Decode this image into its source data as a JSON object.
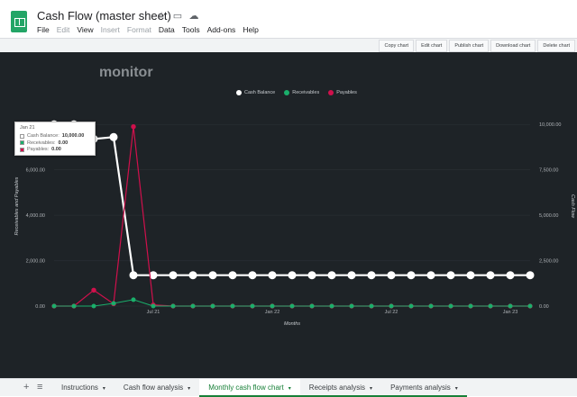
{
  "doc": {
    "title": "Cash Flow (master sheet)"
  },
  "icons": [
    "star-icon",
    "folder-move-icon",
    "cloud-status-icon"
  ],
  "menu": [
    {
      "label": "File",
      "disabled": false
    },
    {
      "label": "Edit",
      "disabled": true
    },
    {
      "label": "View",
      "disabled": false
    },
    {
      "label": "Insert",
      "disabled": true
    },
    {
      "label": "Format",
      "disabled": true
    },
    {
      "label": "Data",
      "disabled": false
    },
    {
      "label": "Tools",
      "disabled": false
    },
    {
      "label": "Add-ons",
      "disabled": false
    },
    {
      "label": "Help",
      "disabled": false
    }
  ],
  "chart_buttons": [
    "Copy chart",
    "Edit chart",
    "Publish chart",
    "Download chart",
    "Delete chart"
  ],
  "chart_title_visible": "monitor",
  "tooltip": {
    "date": "Jan 21",
    "rows": [
      {
        "label": "Cash Balance:",
        "value": "10,000.00",
        "color": "#ffffff"
      },
      {
        "label": "Receivables:",
        "value": "0.00",
        "color": "#1aaf6b"
      },
      {
        "label": "Payables:",
        "value": "0.00",
        "color": "#d0104c"
      }
    ]
  },
  "chart_data": {
    "type": "line",
    "xlabel": "Months",
    "ylabel_left": "Receivables and Payables",
    "ylabel_right": "Cash Flow",
    "x_ticks": [
      "Jul 21",
      "Jan 22",
      "Jul 22",
      "Jan 23"
    ],
    "y_left_ticks": [
      "0.00",
      "2,000.00",
      "4,000.00",
      "6,000.00",
      "8,000.00"
    ],
    "y_right_ticks": [
      "0.00",
      "2,500.00",
      "5,000.00",
      "7,500.00",
      "10,000.00"
    ],
    "ylim_left": [
      0,
      8800
    ],
    "ylim_right": [
      0,
      11000
    ],
    "legend_position": "top",
    "colors": {
      "cash": "#ffffff",
      "receivables": "#1aaf6b",
      "payables": "#d0104c"
    },
    "series": [
      {
        "name": "Cash Balance",
        "axis": "right",
        "values": [
          10000,
          10000,
          9200,
          9300,
          1700,
          1700,
          1700,
          1700,
          1700,
          1700,
          1700,
          1700,
          1700,
          1700,
          1700,
          1700,
          1700,
          1700,
          1700,
          1700,
          1700,
          1700,
          1700,
          1700,
          1700
        ]
      },
      {
        "name": "Receivables",
        "axis": "left",
        "values": [
          0,
          0,
          0,
          120,
          280,
          0,
          0,
          0,
          0,
          0,
          0,
          0,
          0,
          0,
          0,
          0,
          0,
          0,
          0,
          0,
          0,
          0,
          0,
          0,
          0
        ]
      },
      {
        "name": "Payables",
        "axis": "left",
        "values": [
          0,
          0,
          700,
          100,
          7900,
          50,
          0,
          0,
          0,
          0,
          0,
          0,
          0,
          0,
          0,
          0,
          0,
          0,
          0,
          0,
          0,
          0,
          0,
          0,
          0
        ]
      }
    ]
  },
  "sheet_tabs": [
    {
      "label": "Instructions",
      "active": false,
      "green": false
    },
    {
      "label": "Cash flow analysis",
      "active": false,
      "green": false
    },
    {
      "label": "Monthly cash flow chart",
      "active": true,
      "green": true
    },
    {
      "label": "Receipts analysis",
      "active": false,
      "green": true
    },
    {
      "label": "Payments analysis",
      "active": false,
      "green": true
    }
  ]
}
